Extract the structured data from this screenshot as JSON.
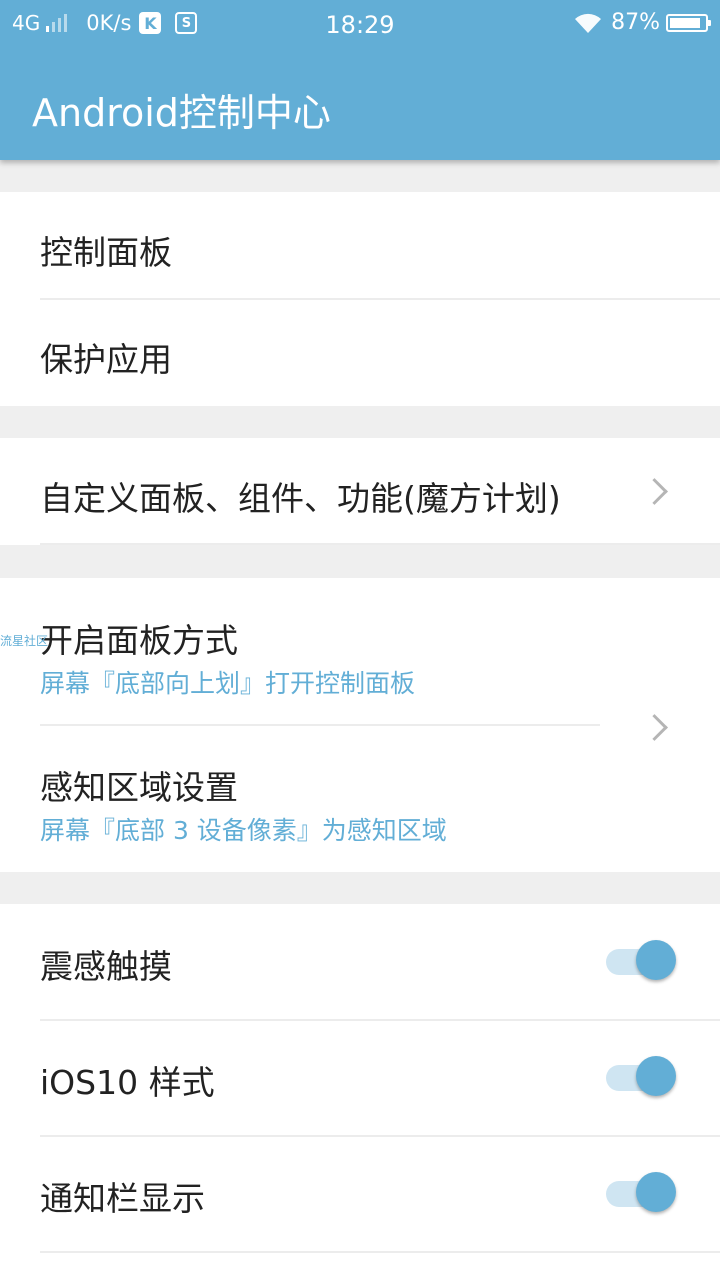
{
  "status_bar": {
    "network": "4G",
    "speed": "0K/s",
    "app_icon_1": "K",
    "app_icon_2": "S",
    "time": "18:29",
    "battery_percent": "87%",
    "battery_level": 0.87
  },
  "app_bar": {
    "title": "Android控制中心"
  },
  "groups": {
    "panel": {
      "control_panel": "控制面板",
      "protected_apps": "保护应用"
    },
    "customize": {
      "label": "自定义面板、组件、功能(魔方计划)",
      "icon": "chevron-right-icon"
    },
    "gesture": {
      "open_method": "开启面板方式",
      "open_method_value": "屏幕『底部向上划』打开控制面板",
      "sensing_area": "感知区域设置",
      "sensing_area_value": "屏幕『底部 3 设备像素』为感知区域",
      "icon": "chevron-right-icon"
    },
    "toggles": [
      {
        "label": "震感触摸",
        "on": true
      },
      {
        "label": "iOS10 样式",
        "on": true
      },
      {
        "label": "通知栏显示",
        "on": true
      }
    ]
  },
  "watermark": "流星社区",
  "colors": {
    "accent": "#62aed6",
    "background": "#efefef",
    "text": "#222222"
  }
}
